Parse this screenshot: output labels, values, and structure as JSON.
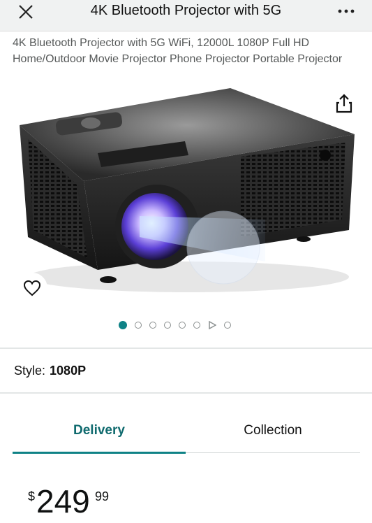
{
  "header": {
    "title": "4K Bluetooth Projector with 5G",
    "close_icon": "close-icon",
    "more_icon": "more-options-icon"
  },
  "product": {
    "title": "4K Bluetooth Projector with 5G WiFi, 12000L 1080P Full HD Home/Outdoor Movie Projector Phone Projector Portable Projector"
  },
  "gallery": {
    "share_icon": "share-icon",
    "wishlist_icon": "heart-icon",
    "image_subject": "projector-image"
  },
  "style": {
    "label": "Style:",
    "value": "1080P"
  },
  "tabs": [
    {
      "label": "Delivery",
      "active": true
    },
    {
      "label": "Collection",
      "active": false
    }
  ],
  "price": {
    "currency": "$",
    "whole": "249",
    "fraction": "99"
  },
  "colors": {
    "accent": "#0f8286",
    "header_bg": "#f0f2f2"
  }
}
